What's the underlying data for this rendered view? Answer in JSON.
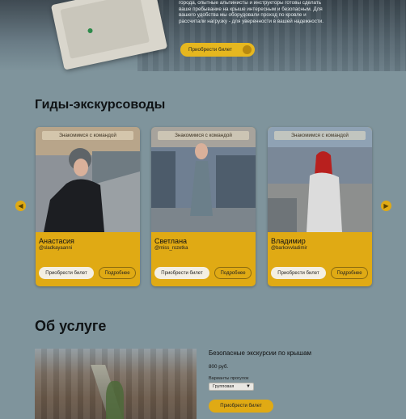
{
  "hero": {
    "text_lines": [
      "города, опытные альпинисты и инструкторы готовы сделать",
      "ваше пребывание на крыше интересным и безопасным. Для",
      "вашего удобства мы оборудовали проход по кровле и",
      "рассчитали нагрузку - для уверенности в вашей надежности."
    ],
    "buy_label": "Приобрести билет"
  },
  "guides": {
    "title": "Гиды-экскурсоводы",
    "tag": "Знакомимся с командой",
    "buy_label": "Приобрести билет",
    "more_label": "Подробнее",
    "items": [
      {
        "name": "Анастасия",
        "nick": "@sladkayaanni"
      },
      {
        "name": "Светлана",
        "nick": "@miss_rozetka"
      },
      {
        "name": "Владимир",
        "nick": "@barkovvladimir"
      }
    ]
  },
  "service": {
    "title": "Об услуге",
    "product_title": "Безопасные экскурсии по крышам",
    "price": "800 руб.",
    "options_label": "Варианты прогулок",
    "option_selected": "Групповая",
    "buy_label": "Приобрести билет"
  },
  "icons": {
    "prev": "chevron-left-icon",
    "next": "chevron-right-icon"
  },
  "colors": {
    "accent": "#e0aa14",
    "background": "#7f949c"
  }
}
